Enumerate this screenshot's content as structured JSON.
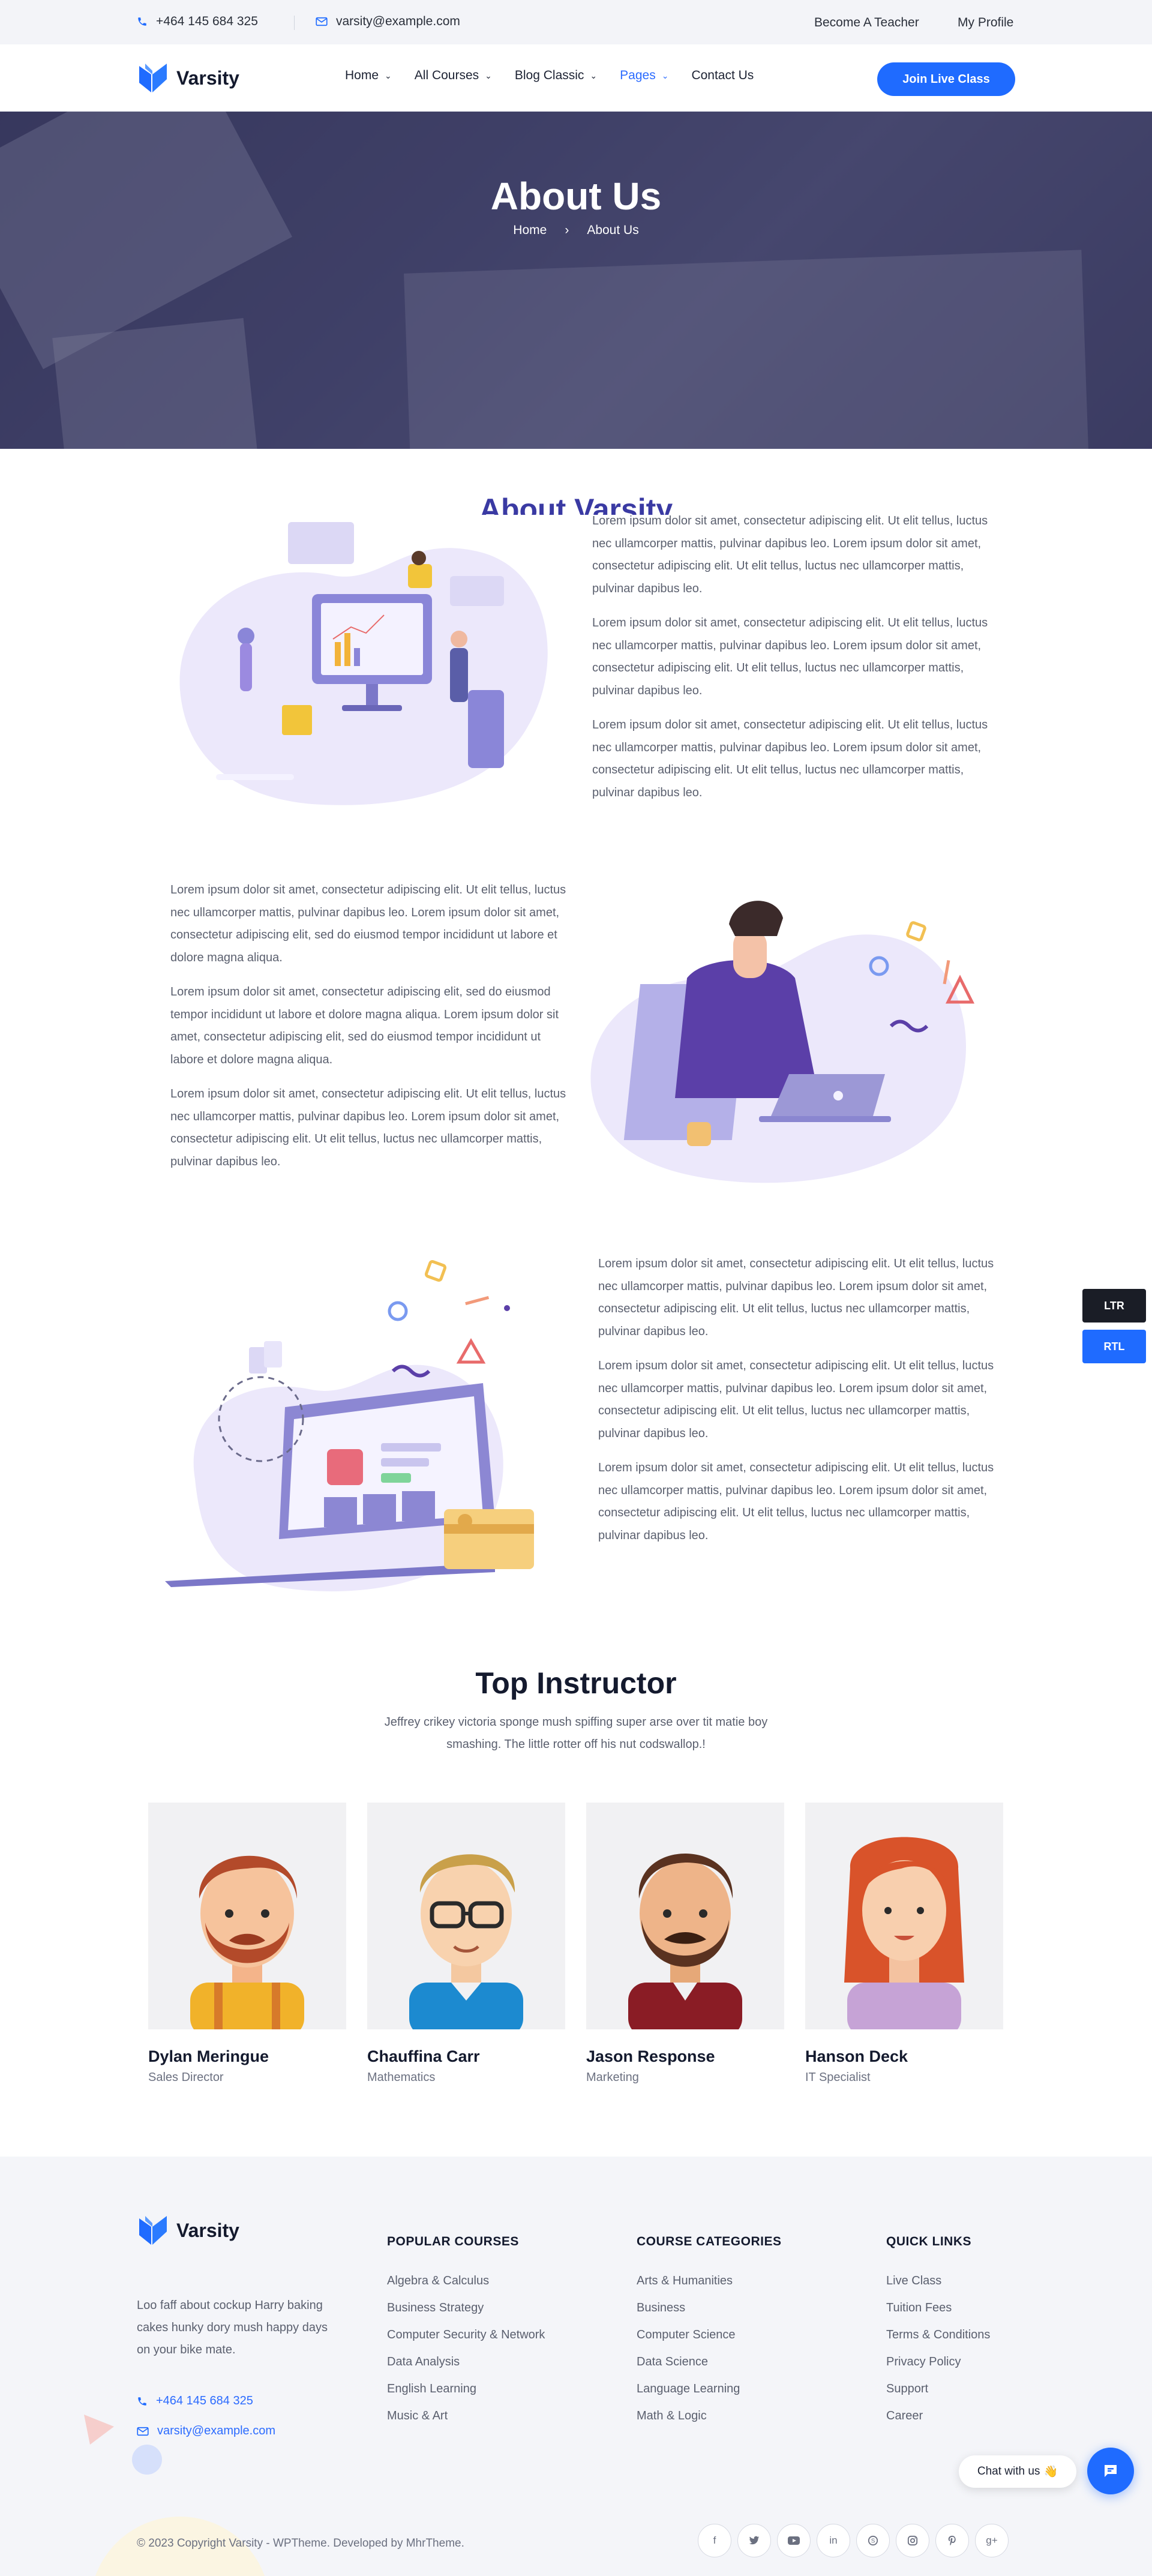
{
  "topbar": {
    "phone": "+464 145 684 325",
    "email": "varsity@example.com",
    "become_teacher": "Become A Teacher",
    "my_profile": "My Profile"
  },
  "header": {
    "logo_text": "Varsity",
    "nav": [
      {
        "label": "Home"
      },
      {
        "label": "All Courses"
      },
      {
        "label": "Blog Classic"
      },
      {
        "label": "Pages"
      },
      {
        "label": "Contact Us"
      }
    ],
    "cta": "Join Live Class"
  },
  "hero": {
    "title": "About Us",
    "breadcrumb_home": "Home",
    "breadcrumb_sep": "›",
    "breadcrumb_current": "About Us"
  },
  "about": {
    "title": "About Varsity",
    "block1": [
      "Lorem ipsum dolor sit amet, consectetur adipiscing elit. Ut elit tellus, luctus nec ullamcorper mattis, pulvinar dapibus leo. Lorem ipsum dolor sit amet, consectetur adipiscing elit. Ut elit tellus, luctus nec ullamcorper mattis, pulvinar dapibus leo.",
      "Lorem ipsum dolor sit amet, consectetur adipiscing elit. Ut elit tellus, luctus nec ullamcorper mattis, pulvinar dapibus leo. Lorem ipsum dolor sit amet, consectetur adipiscing elit. Ut elit tellus, luctus nec ullamcorper mattis, pulvinar dapibus leo.",
      "Lorem ipsum dolor sit amet, consectetur adipiscing elit. Ut elit tellus, luctus nec ullamcorper mattis, pulvinar dapibus leo. Lorem ipsum dolor sit amet, consectetur adipiscing elit. Ut elit tellus, luctus nec ullamcorper mattis, pulvinar dapibus leo."
    ],
    "block2": [
      "Lorem ipsum dolor sit amet, consectetur adipiscing elit. Ut elit tellus, luctus nec ullamcorper mattis, pulvinar dapibus leo. Lorem ipsum dolor sit amet, consectetur adipiscing elit, sed do eiusmod tempor incididunt ut labore et dolore magna aliqua.",
      "Lorem ipsum dolor sit amet, consectetur adipiscing elit, sed do eiusmod tempor incididunt ut labore et dolore magna aliqua. Lorem ipsum dolor sit amet, consectetur adipiscing elit, sed do eiusmod tempor incididunt ut labore et dolore magna aliqua.",
      "Lorem ipsum dolor sit amet, consectetur adipiscing elit. Ut elit tellus, luctus nec ullamcorper mattis, pulvinar dapibus leo. Lorem ipsum dolor sit amet, consectetur adipiscing elit. Ut elit tellus, luctus nec ullamcorper mattis, pulvinar dapibus leo."
    ],
    "block3": [
      "Lorem ipsum dolor sit amet, consectetur adipiscing elit. Ut elit tellus, luctus nec ullamcorper mattis, pulvinar dapibus leo. Lorem ipsum dolor sit amet, consectetur adipiscing elit. Ut elit tellus, luctus nec ullamcorper mattis, pulvinar dapibus leo.",
      "Lorem ipsum dolor sit amet, consectetur adipiscing elit. Ut elit tellus, luctus nec ullamcorper mattis, pulvinar dapibus leo. Lorem ipsum dolor sit amet, consectetur adipiscing elit. Ut elit tellus, luctus nec ullamcorper mattis, pulvinar dapibus leo.",
      "Lorem ipsum dolor sit amet, consectetur adipiscing elit. Ut elit tellus, luctus nec ullamcorper mattis, pulvinar dapibus leo. Lorem ipsum dolor sit amet, consectetur adipiscing elit. Ut elit tellus, luctus nec ullamcorper mattis, pulvinar dapibus leo."
    ]
  },
  "direction": {
    "ltr": "LTR",
    "rtl": "RTL"
  },
  "instructors": {
    "title": "Top Instructor",
    "subtitle": "Jeffrey crikey victoria sponge mush spiffing super arse over tit matie boy smashing. The little rotter off his nut codswallop.!",
    "people": [
      {
        "name": "Dylan Meringue",
        "role": "Sales Director"
      },
      {
        "name": "Chauffina Carr",
        "role": "Mathematics"
      },
      {
        "name": "Jason Response",
        "role": "Marketing"
      },
      {
        "name": "Hanson Deck",
        "role": "IT Specialist"
      }
    ]
  },
  "footer": {
    "logo_text": "Varsity",
    "about": "Loo faff about cockup Harry baking cakes hunky dory mush happy days on your bike mate.",
    "phone": "+464 145 684 325",
    "email": "varsity@example.com",
    "columns": [
      {
        "title": "POPULAR COURSES",
        "links": [
          "Algebra & Calculus",
          "Business Strategy",
          "Computer Security & Network",
          "Data Analysis",
          "English Learning",
          "Music & Art"
        ]
      },
      {
        "title": "COURSE CATEGORIES",
        "links": [
          "Arts & Humanities",
          "Business",
          "Computer Science",
          "Data Science",
          "Language Learning",
          "Math & Logic"
        ]
      },
      {
        "title": "QUICK LINKS",
        "links": [
          "Live Class",
          "Tuition Fees",
          "Terms & Conditions",
          "Privacy Policy",
          "Support",
          "Career"
        ]
      }
    ],
    "copyright": "© 2023 Copyright Varsity - WPTheme. Developed by MhrTheme.",
    "social": [
      "facebook-icon",
      "twitter-icon",
      "youtube-icon",
      "linkedin-icon",
      "skype-icon",
      "instagram-icon",
      "pinterest-icon",
      "google-plus-icon"
    ]
  },
  "chat": {
    "label": "Chat with us",
    "emoji": "👋"
  },
  "colors": {
    "primary": "#1f6bff",
    "heading": "#141a2e",
    "about_title": "#3a3aa3",
    "footer_bg": "#f4f5f9"
  }
}
